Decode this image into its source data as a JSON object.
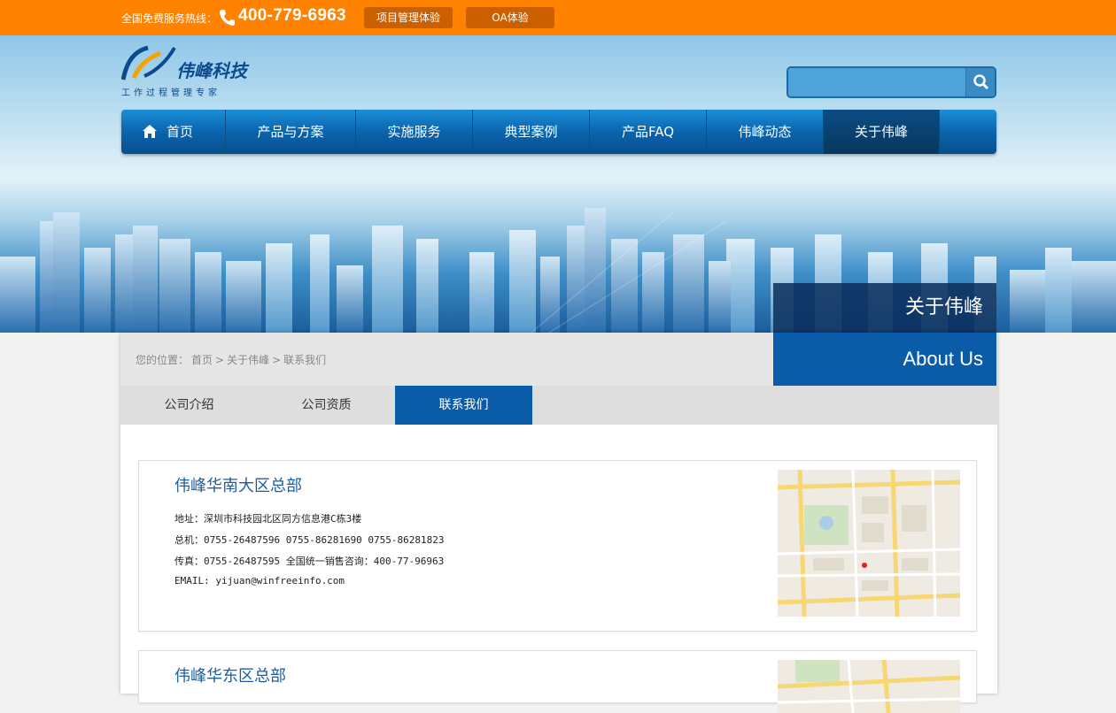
{
  "topbar": {
    "hotline_label": "全国免费服务热线：",
    "hotline_number": "400-779-6963",
    "btn_project": "项目管理体验",
    "btn_oa": "OA体验"
  },
  "logo": {
    "name": "伟峰科技",
    "slogan": "工作过程管理专家"
  },
  "search": {
    "placeholder": ""
  },
  "nav": {
    "items": [
      "首页",
      "产品与方案",
      "实施服务",
      "典型案例",
      "产品FAQ",
      "伟峰动态",
      "关于伟峰"
    ]
  },
  "section": {
    "title_cn": "关于伟峰",
    "title_en": "About Us"
  },
  "breadcrumb": {
    "prefix": "您的位置：",
    "home": "首页",
    "sep1": ">",
    "about": "关于伟峰",
    "sep2": ">",
    "current": "联系我们"
  },
  "tabs": [
    "公司介绍",
    "公司资质",
    "联系我们"
  ],
  "offices": [
    {
      "name": "伟峰华南大区总部",
      "address": "地址：深圳市科技园北区同方信息港C栋3楼",
      "phone": "总机：0755-26487596 0755-86281690 0755-86281823",
      "fax": "传真：0755-26487595 全国统一销售咨询：400-77-96963",
      "email": "EMAIL: yijuan@winfreeinfo.com"
    },
    {
      "name": "伟峰华东区总部"
    }
  ],
  "colors": {
    "topbar": "#ff8200",
    "nav": "#0a64ad",
    "active": "#0a5ca8"
  }
}
